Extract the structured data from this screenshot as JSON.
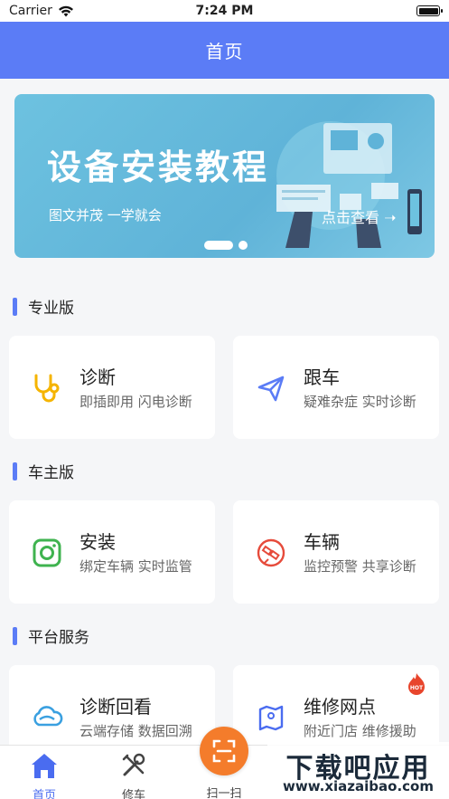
{
  "status_bar": {
    "carrier": "Carrier",
    "time": "7:24 PM"
  },
  "nav": {
    "title": "首页"
  },
  "banner": {
    "title": "设备安装教程",
    "subtitle": "图文并茂  一学就会",
    "cta": "点击查看 ➝",
    "page_count": 2,
    "active_page": 1
  },
  "sections": [
    {
      "title": "专业版",
      "cards": [
        {
          "title": "诊断",
          "subtitle": "即插即用 闪电诊断",
          "icon": "stethoscope-icon",
          "color": "#f5b400"
        },
        {
          "title": "跟车",
          "subtitle": "疑难杂症 实时诊断",
          "icon": "paper-plane-icon",
          "color": "#5b7cf6"
        }
      ]
    },
    {
      "title": "车主版",
      "cards": [
        {
          "title": "安装",
          "subtitle": "绑定车辆 实时监管",
          "icon": "install-icon",
          "color": "#3fb34f"
        },
        {
          "title": "车辆",
          "subtitle": "监控预警 共享诊断",
          "icon": "satellite-icon",
          "color": "#e64b3b"
        }
      ]
    },
    {
      "title": "平台服务",
      "cards": [
        {
          "title": "诊断回看",
          "subtitle": "云端存储 数据回溯",
          "icon": "cloud-icon",
          "color": "#3aa0e0"
        },
        {
          "title": "维修网点",
          "subtitle": "附近门店 维修援助",
          "icon": "map-pin-icon",
          "color": "#4a6cf0",
          "badge": "HOT"
        }
      ]
    }
  ],
  "tabs": [
    {
      "label": "首页",
      "icon": "home-icon"
    },
    {
      "label": "修车",
      "icon": "tools-icon"
    },
    {
      "label": "扫一扫",
      "icon": "scan-icon"
    }
  ],
  "watermark": {
    "main": "下载吧应用",
    "url": "www.xiazaibao.com"
  },
  "colors": {
    "primary": "#5b7cf6",
    "scan": "#f47c2b",
    "tab_active": "#4a6cf0"
  }
}
